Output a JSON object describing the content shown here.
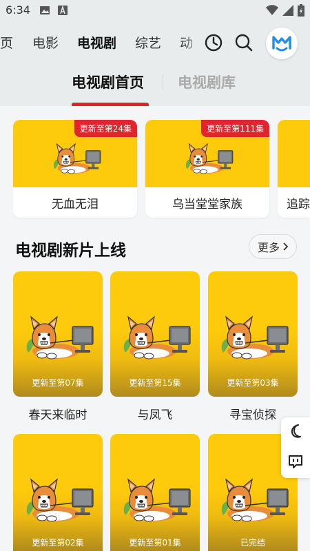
{
  "status_bar": {
    "time": "6:34",
    "icons": [
      "image-icon",
      "a-icon",
      "wifi-icon",
      "signal-icon",
      "battery-icon"
    ]
  },
  "nav": {
    "tabs": [
      {
        "label": "页",
        "active": false
      },
      {
        "label": "电影",
        "active": false
      },
      {
        "label": "电视剧",
        "active": true
      },
      {
        "label": "综艺",
        "active": false
      },
      {
        "label": "动",
        "active": false
      }
    ],
    "icons": [
      "history-clock-icon",
      "search-icon",
      "app-logo-avatar"
    ],
    "accent": "#f6c62c"
  },
  "sub_tabs": [
    {
      "label": "电视剧首页",
      "active": true
    },
    {
      "label": "电视剧库",
      "active": false
    }
  ],
  "featured": [
    {
      "title": "无血无泪",
      "badge": "更新至第24集"
    },
    {
      "title": "乌当堂堂家族",
      "badge": "更新至第111集"
    },
    {
      "title": "追踪"
    }
  ],
  "section": {
    "title": "电视剧新片上线",
    "more_label": "更多"
  },
  "grid": [
    {
      "title": "春天来临时",
      "episode": "更新至第07集"
    },
    {
      "title": "与凤飞",
      "episode": "更新至第15集"
    },
    {
      "title": "寻宝侦探",
      "episode": "更新至第03集"
    },
    {
      "episode": "更新至第02集"
    },
    {
      "episode": "更新至第01集"
    },
    {
      "episode": "已完结"
    }
  ],
  "side_panel": [
    "dark-mode-moon-icon",
    "message-feedback-icon"
  ],
  "colors": {
    "badge_red": "#e0252f",
    "poster_yellow": "#fdca0c",
    "active_underline": "#d9232e"
  }
}
